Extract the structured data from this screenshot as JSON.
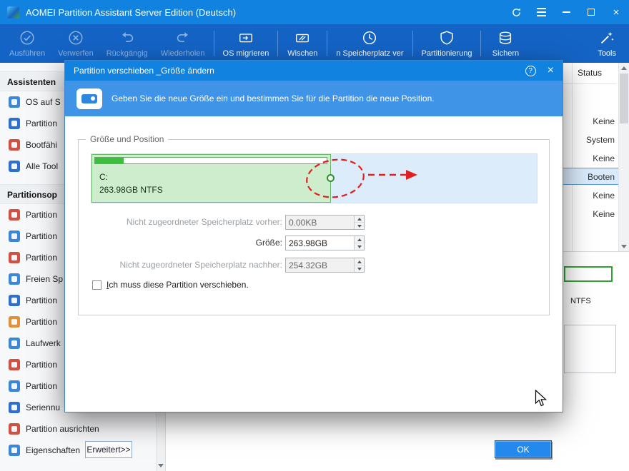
{
  "titlebar": {
    "title": "AOMEI Partition Assistant Server Edition (Deutsch)"
  },
  "icons": {
    "help": "?",
    "close": "×"
  },
  "toolbar": {
    "items": [
      {
        "label": "Ausführen"
      },
      {
        "label": "Verwerfen"
      },
      {
        "label": "Rückgängig"
      },
      {
        "label": "Wiederholen"
      },
      {
        "label": "OS migrieren"
      },
      {
        "label": "Wischen"
      },
      {
        "label": "n Speicherplatz ver"
      },
      {
        "label": "Partitionierung"
      },
      {
        "label": "Sichern"
      }
    ],
    "tools_label": "Tools"
  },
  "sidebar": {
    "sections": [
      {
        "title": "Assistenten",
        "items": [
          {
            "label": "OS auf S"
          },
          {
            "label": "Partition"
          },
          {
            "label": "Bootfähi"
          },
          {
            "label": "Alle Tool"
          }
        ]
      },
      {
        "title": "Partitionsop",
        "items": [
          {
            "label": "Partition"
          },
          {
            "label": "Partition"
          },
          {
            "label": "Partition"
          },
          {
            "label": "Freien Sp"
          },
          {
            "label": "Partition"
          },
          {
            "label": "Partition"
          },
          {
            "label": "Laufwerk"
          },
          {
            "label": "Partition"
          },
          {
            "label": "Partition"
          },
          {
            "label": "Seriennu"
          },
          {
            "label": "Partition ausrichten"
          },
          {
            "label": "Eigenschaften"
          }
        ]
      }
    ]
  },
  "main": {
    "status_header": "Status",
    "status_rows": [
      "Keine",
      "System",
      "Keine",
      "Booten",
      "Keine",
      "Keine"
    ],
    "selected_status": "Booten",
    "fs_label": "NTFS"
  },
  "dialog": {
    "title": "Partition verschieben _Größe ändern",
    "banner": "Geben Sie die neue Größe ein und bestimmen Sie für die Partition die neue Position.",
    "group_legend": "Größe und Position",
    "partition": {
      "name": "C:",
      "details": "263.98GB NTFS"
    },
    "fields": [
      {
        "label": "Nicht zugeordneter Speicherplatz vorher:",
        "value": "0.00KB"
      },
      {
        "label": "Größe:",
        "value": "263.98GB"
      },
      {
        "label": "Nicht zugeordneter Speicherplatz nachher:",
        "value": "254.32GB"
      }
    ],
    "checkbox_label": "Ich muss diese Partition verschieben.",
    "advanced_button": "Erweitert>>",
    "ok_button": "OK"
  },
  "colors": {
    "accent": "#1282e0",
    "toolbar": "#1464c6",
    "partition_green": "#3dbd3d",
    "annotation_red": "#e02020",
    "selection": "#d8eafb"
  }
}
